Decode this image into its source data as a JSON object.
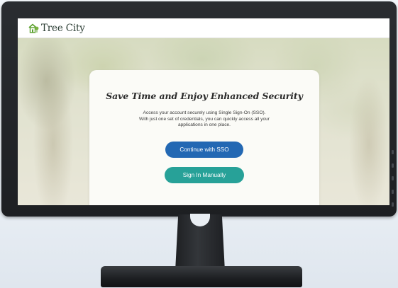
{
  "app": {
    "logo_text": "Tree City"
  },
  "card": {
    "title": "Save Time and Enjoy Enhanced Security",
    "description_line1": "Access your account securely using Single Sign-On (SSO).",
    "description_line2": "With just one set of credentials, you can quickly access all your",
    "description_line3": "applications in one place."
  },
  "buttons": {
    "sso_label": "Continue with SSO",
    "manual_label": "Sign In Manually"
  },
  "colors": {
    "sso_button": "#2368b3",
    "manual_button": "#27a198",
    "logo_green": "#5aa02c"
  },
  "icons": {
    "logo": "tree-house-icon"
  }
}
